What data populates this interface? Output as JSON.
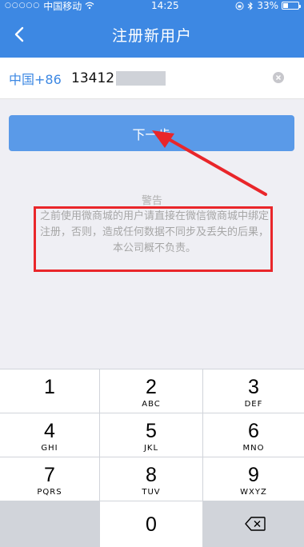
{
  "status_bar": {
    "carrier": "中国移动",
    "time": "14:25",
    "battery": "33%",
    "battery_level": 0.33
  },
  "navbar": {
    "title": "注册新用户"
  },
  "phone_field": {
    "country_code": "中国+86",
    "value": "13412"
  },
  "next_button": {
    "label": "下一步"
  },
  "warning": {
    "title": "警告",
    "text": "之前使用微商城的用户请直接在微信微商城中绑定注册，否则，造成任何数据不同步及丢失的后果，本公司概不负责。"
  },
  "keypad": {
    "keys": [
      {
        "num": "1",
        "letters": ""
      },
      {
        "num": "2",
        "letters": "ABC"
      },
      {
        "num": "3",
        "letters": "DEF"
      },
      {
        "num": "4",
        "letters": "GHI"
      },
      {
        "num": "5",
        "letters": "JKL"
      },
      {
        "num": "6",
        "letters": "MNO"
      },
      {
        "num": "7",
        "letters": "PQRS"
      },
      {
        "num": "8",
        "letters": "TUV"
      },
      {
        "num": "9",
        "letters": "WXYZ"
      },
      {
        "num": "0",
        "letters": ""
      }
    ]
  },
  "colors": {
    "brand": "#3d88e3",
    "annotation": "#e9262a"
  }
}
